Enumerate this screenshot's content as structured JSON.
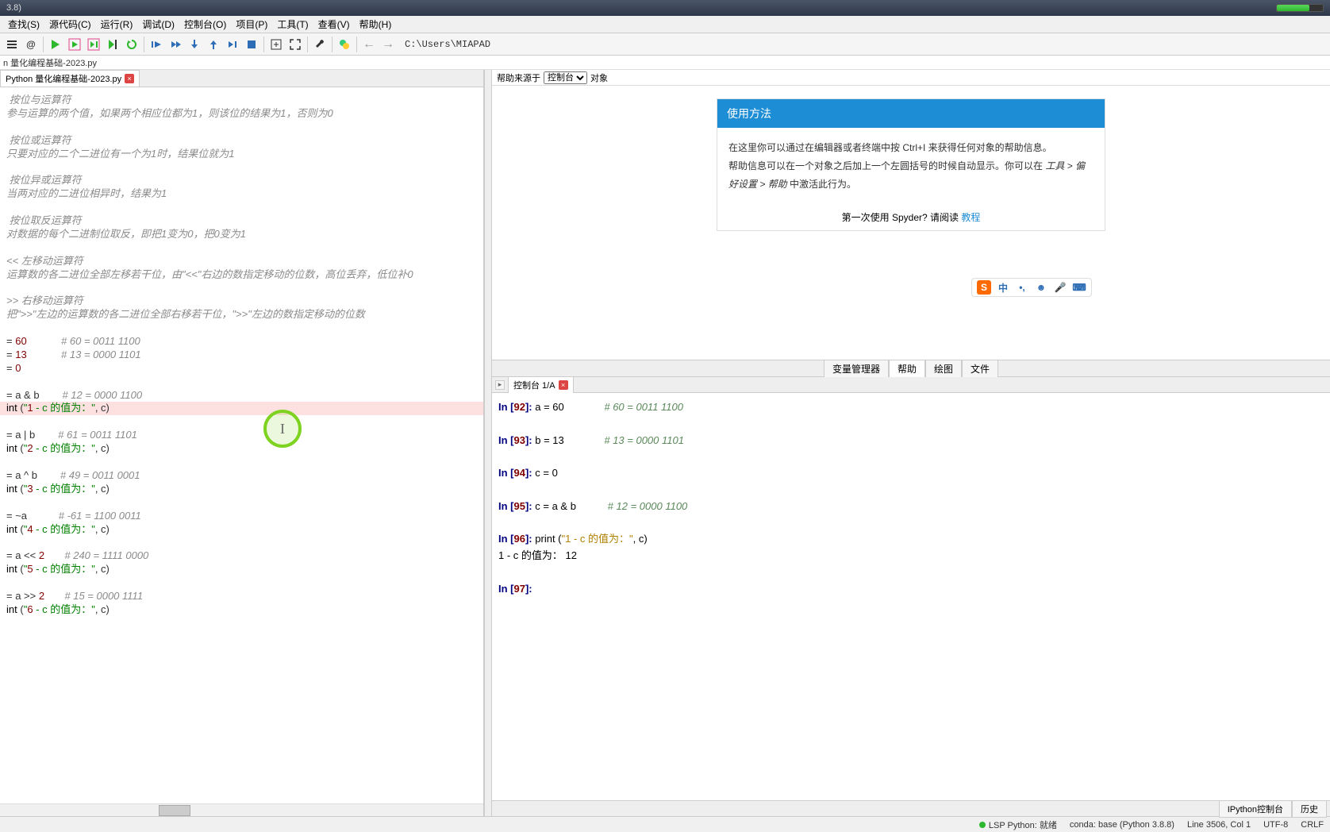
{
  "titlebar": {
    "text": "3.8)"
  },
  "menu": {
    "items": [
      "查找(S)",
      "源代码(C)",
      "运行(R)",
      "调试(D)",
      "控制台(O)",
      "项目(P)",
      "工具(T)",
      "查看(V)",
      "帮助(H)"
    ]
  },
  "breadcrumb": "C:\\Users\\MIAPAD",
  "path_row": "n 量化编程基础-2023.py",
  "editor": {
    "tab_label": "Python 量化编程基础-2023.py",
    "lines": [
      {
        "cls": "comment",
        "text": " 按位与运算符"
      },
      {
        "cls": "comment",
        "text": "参与运算的两个值，如果两个相应位都为1，则该位的结果为1，否则为0"
      },
      {
        "cls": "",
        "text": ""
      },
      {
        "cls": "comment",
        "text": " 按位或运算符"
      },
      {
        "cls": "comment",
        "text": "只要对应的二个二进位有一个为1时，结果位就为1"
      },
      {
        "cls": "",
        "text": ""
      },
      {
        "cls": "comment",
        "text": " 按位异或运算符"
      },
      {
        "cls": "comment",
        "text": "当两对应的二进位相异时，结果为1"
      },
      {
        "cls": "",
        "text": ""
      },
      {
        "cls": "comment",
        "text": " 按位取反运算符"
      },
      {
        "cls": "comment",
        "text": "对数据的每个二进制位取反，即把1变为0，把0变为1"
      },
      {
        "cls": "",
        "text": ""
      },
      {
        "cls": "comment",
        "text": "<< 左移动运算符"
      },
      {
        "cls": "comment",
        "text": "运算数的各二进位全部左移若干位，由\"<<\"右边的数指定移动的位数，高位丢弃，低位补0"
      },
      {
        "cls": "",
        "text": ""
      },
      {
        "cls": "comment",
        "text": ">> 右移动运算符"
      },
      {
        "cls": "comment",
        "text": "把\">>\"左边的运算数的各二进位全部右移若干位，\">>\"左边的数指定移动的位数"
      },
      {
        "cls": "",
        "text": ""
      },
      {
        "cls": "mixed",
        "text": "= 60            # 60 = 0011 1100"
      },
      {
        "cls": "mixed",
        "text": "= 13            # 13 = 0000 1101"
      },
      {
        "cls": "mixed",
        "text": "= 0"
      },
      {
        "cls": "",
        "text": ""
      },
      {
        "cls": "mixed",
        "text": "= a & b        # 12 = 0000 1100"
      },
      {
        "cls": "mixed",
        "text": "int (\"1 - c 的值为：\", c)",
        "hl": true
      },
      {
        "cls": "",
        "text": ""
      },
      {
        "cls": "mixed",
        "text": "= a | b        # 61 = 0011 1101"
      },
      {
        "cls": "mixed",
        "text": "int (\"2 - c 的值为：\", c)"
      },
      {
        "cls": "",
        "text": ""
      },
      {
        "cls": "mixed",
        "text": "= a ^ b        # 49 = 0011 0001"
      },
      {
        "cls": "mixed",
        "text": "int (\"3 - c 的值为：\", c)"
      },
      {
        "cls": "",
        "text": ""
      },
      {
        "cls": "mixed",
        "text": "= ~a           # -61 = 1100 0011"
      },
      {
        "cls": "mixed",
        "text": "int (\"4 - c 的值为：\", c)"
      },
      {
        "cls": "",
        "text": ""
      },
      {
        "cls": "mixed",
        "text": "= a << 2       # 240 = 1111 0000"
      },
      {
        "cls": "mixed",
        "text": "int (\"5 - c 的值为：\", c)"
      },
      {
        "cls": "",
        "text": ""
      },
      {
        "cls": "mixed",
        "text": "= a >> 2       # 15 = 0000 1111"
      },
      {
        "cls": "mixed",
        "text": "int (\"6 - c 的值为：\", c)"
      }
    ]
  },
  "help": {
    "source_label": "帮助来源于",
    "source_value": "控制台",
    "object_label": "对象",
    "card_title": "使用方法",
    "body_line1": "在这里你可以通过在编辑器或者终端中按 Ctrl+I 来获得任何对象的帮助信息。",
    "body_line2a": "帮助信息可以在一个对象之后加上一个左圆括号的时候自动显示。你可以在 ",
    "body_line2b": "工具 > 偏好设置 > 帮助",
    "body_line2c": " 中激活此行为。",
    "footer_text": "第一次使用 Spyder? 请阅读 ",
    "footer_link": "教程",
    "tabs": [
      "变量管理器",
      "帮助",
      "绘图",
      "文件"
    ]
  },
  "console": {
    "tab_label": "控制台 1/A",
    "lines": [
      {
        "n": "92",
        "code": "a = 60",
        "cmt": "# 60 = 0011 1100"
      },
      {
        "n": "93",
        "code": "b = 13",
        "cmt": "# 13 = 0000 1101"
      },
      {
        "n": "94",
        "code": "c = 0",
        "cmt": ""
      },
      {
        "n": "95",
        "code": "c = a & b",
        "cmt": "# 12 = 0000 1100"
      },
      {
        "n": "96",
        "code": "print (\"1 - c 的值为：\", c)",
        "cmt": "",
        "print": true
      }
    ],
    "output": "1 - c 的值为： 12",
    "prompt_n": "97",
    "bottom_tabs": [
      "IPython控制台",
      "历史"
    ]
  },
  "status": {
    "lsp": "LSP Python: 就绪",
    "conda": "conda: base (Python 3.8.8)",
    "line": "Line 3506, Col 1",
    "enc": "UTF-8",
    "eol": "CRLF"
  },
  "ime": {
    "lang": "中"
  }
}
